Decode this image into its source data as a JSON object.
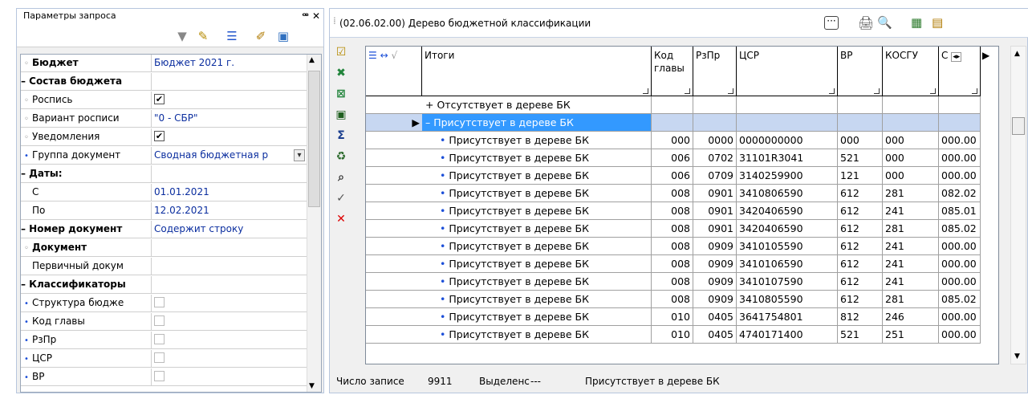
{
  "left_panel": {
    "title": "Параметры запроса",
    "close": "ꟹ ✕",
    "toolbar": [
      "funnel-icon",
      "brush-icon",
      "list-icon",
      "edit-icon",
      "save-icon"
    ],
    "rows": [
      {
        "kind": "item",
        "indent": 0,
        "name": "Бюджет",
        "value": "Бюджет 2021 г.",
        "bold": true,
        "glyph": "◦"
      },
      {
        "kind": "cat",
        "name": "– Состав бюджета",
        "value": ""
      },
      {
        "kind": "item",
        "name": "Роспись",
        "value": "",
        "check": true,
        "glyph": "◦"
      },
      {
        "kind": "item",
        "name": "Вариант росписи",
        "value": "\"0 - СБР\"",
        "glyph": "◦"
      },
      {
        "kind": "item",
        "name": "Уведомления",
        "value": "",
        "check": true,
        "glyph": "◦"
      },
      {
        "kind": "item",
        "name": "Группа документ",
        "value": "Сводная бюджетная р",
        "glyph": "•",
        "dropdown": true
      },
      {
        "kind": "cat",
        "name": "– Даты:",
        "value": ""
      },
      {
        "kind": "item",
        "name": "С",
        "value": "01.01.2021",
        "glyph": ""
      },
      {
        "kind": "item",
        "name": "По",
        "value": "12.02.2021",
        "glyph": ""
      },
      {
        "kind": "cat",
        "name": "– Номер документ",
        "value": "Содержит строку"
      },
      {
        "kind": "item",
        "name": "Документ",
        "value": "",
        "bold": true,
        "glyph": "◦"
      },
      {
        "kind": "item",
        "name": "Первичный докум",
        "value": "",
        "glyph": ""
      },
      {
        "kind": "cat",
        "name": "– Классификаторы",
        "value": ""
      },
      {
        "kind": "item",
        "name": "Структура бюдже",
        "value": "",
        "check": false,
        "glyph": "•"
      },
      {
        "kind": "item",
        "name": "Код главы",
        "value": "",
        "check": false,
        "glyph": "•"
      },
      {
        "kind": "item",
        "name": "РзПр",
        "value": "",
        "check": false,
        "glyph": "•"
      },
      {
        "kind": "item",
        "name": "ЦСР",
        "value": "",
        "check": false,
        "glyph": "•"
      },
      {
        "kind": "item",
        "name": "ВР",
        "value": "",
        "check": false,
        "glyph": "•"
      }
    ]
  },
  "right_panel": {
    "title": "(02.06.02.00) Дерево бюджетной классификации",
    "dots": "···",
    "headers": {
      "itogi": "Итоги",
      "kod": "Код главы",
      "rzpr": "РзПр",
      "csr": "ЦСР",
      "vr": "ВР",
      "kosgu": "КОСГУ",
      "c": "С"
    },
    "rows": [
      {
        "name": "+ Отсутствует в дереве БК",
        "kod": "",
        "rzpr": "",
        "csr": "",
        "vr": "",
        "kosgu": "",
        "c": "",
        "type": "group"
      },
      {
        "name": "– Присутствует в дереве БК",
        "kod": "",
        "rzpr": "",
        "csr": "",
        "vr": "",
        "kosgu": "",
        "c": "",
        "type": "selected"
      },
      {
        "name": "Присутствует в дереве БК",
        "kod": "000",
        "rzpr": "0000",
        "csr": "0000000000",
        "vr": "000",
        "kosgu": "000",
        "c": "000.00"
      },
      {
        "name": "Присутствует в дереве БК",
        "kod": "006",
        "rzpr": "0702",
        "csr": "31101R3041",
        "vr": "521",
        "kosgu": "000",
        "c": "000.00"
      },
      {
        "name": "Присутствует в дереве БК",
        "kod": "006",
        "rzpr": "0709",
        "csr": "3140259900",
        "vr": "121",
        "kosgu": "000",
        "c": "000.00"
      },
      {
        "name": "Присутствует в дереве БК",
        "kod": "008",
        "rzpr": "0901",
        "csr": "3410806590",
        "vr": "612",
        "kosgu": "281",
        "c": "082.02"
      },
      {
        "name": "Присутствует в дереве БК",
        "kod": "008",
        "rzpr": "0901",
        "csr": "3420406590",
        "vr": "612",
        "kosgu": "241",
        "c": "085.01"
      },
      {
        "name": "Присутствует в дереве БК",
        "kod": "008",
        "rzpr": "0901",
        "csr": "3420406590",
        "vr": "612",
        "kosgu": "281",
        "c": "085.02"
      },
      {
        "name": "Присутствует в дереве БК",
        "kod": "008",
        "rzpr": "0909",
        "csr": "3410105590",
        "vr": "612",
        "kosgu": "241",
        "c": "000.00"
      },
      {
        "name": "Присутствует в дереве БК",
        "kod": "008",
        "rzpr": "0909",
        "csr": "3410106590",
        "vr": "612",
        "kosgu": "241",
        "c": "000.00"
      },
      {
        "name": "Присутствует в дереве БК",
        "kod": "008",
        "rzpr": "0909",
        "csr": "3410107590",
        "vr": "612",
        "kosgu": "241",
        "c": "000.00"
      },
      {
        "name": "Присутствует в дереве БК",
        "kod": "008",
        "rzpr": "0909",
        "csr": "3410805590",
        "vr": "612",
        "kosgu": "281",
        "c": "085.02"
      },
      {
        "name": "Присутствует в дереве БК",
        "kod": "010",
        "rzpr": "0405",
        "csr": "3641754801",
        "vr": "812",
        "kosgu": "246",
        "c": "000.00"
      },
      {
        "name": "Присутствует в дереве БК",
        "kod": "010",
        "rzpr": "0405",
        "csr": "4740171400",
        "vr": "521",
        "kosgu": "251",
        "c": "000.00"
      }
    ],
    "status": {
      "count_label": "Число записе",
      "count_value": "9911",
      "sel_label": "Выделенс",
      "sel_value": "---",
      "current": "Присутствует в дереве БК"
    }
  }
}
